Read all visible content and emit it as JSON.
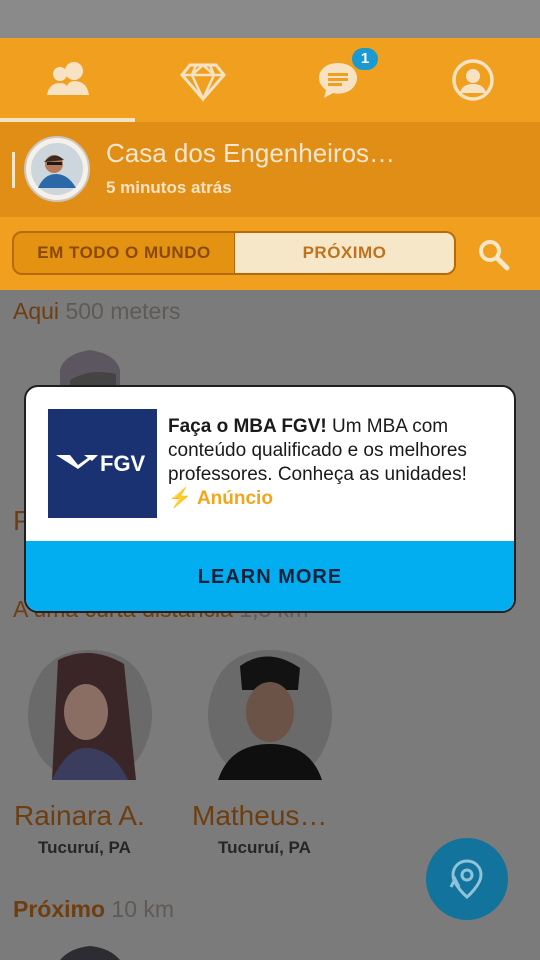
{
  "tabs": [
    {
      "icon": "people-icon",
      "active": true
    },
    {
      "icon": "diamond-icon"
    },
    {
      "icon": "chat-icon",
      "badge": "1"
    },
    {
      "icon": "profile-icon"
    }
  ],
  "place": {
    "title": "Casa dos Engenheiros…",
    "subtitle": "5 minutos atrás"
  },
  "filter": {
    "left": "EM TODO O MUNDO",
    "right": "PRÓXIMO"
  },
  "sections": [
    {
      "label": "Aqui",
      "distance": "500 meters"
    },
    {
      "label": "A uma curta distância",
      "distance": "1,5 km"
    },
    {
      "label": "Próximo",
      "distance": "10 km"
    }
  ],
  "people": [
    {
      "name": "Rainara A.",
      "city": "Tucuruí, PA"
    },
    {
      "name": "Matheus…",
      "city": "Tucuruí, PA"
    }
  ],
  "ad": {
    "headline": "Faça o MBA FGV!",
    "body": " Um MBA com conteúdo qualificado e os melhores professores. Conheça as unidades! ",
    "label": "Anúncio",
    "logo_text": "FGV",
    "cta": "LEARN MORE"
  },
  "colors": {
    "accent": "#f0a01e",
    "ad_button": "#03aef0",
    "badge": "#1a9ad0"
  }
}
